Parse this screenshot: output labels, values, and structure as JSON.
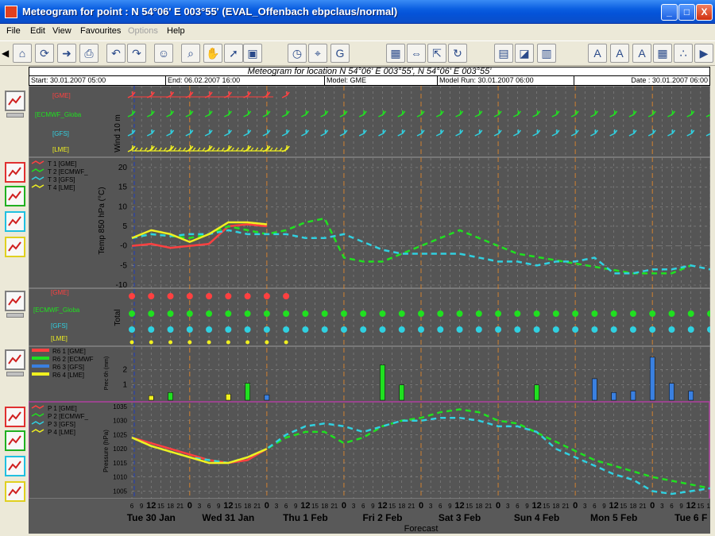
{
  "window": {
    "title": "Meteogram for point : N 54°06' E 003°55' (EVAL_Offenbach ebpclaus/normal)",
    "minimize": "_",
    "maximize": "□",
    "close": "X"
  },
  "menu": [
    "File",
    "Edit",
    "View",
    "Favourites",
    "Options",
    "Help"
  ],
  "menu_disabled": [
    "Options"
  ],
  "toolbar_icons": [
    "back-icon",
    "home-icon",
    "refresh-icon",
    "forward-icon",
    "print-icon",
    "undo-icon",
    "redo-icon",
    "person-icon",
    "zoom-icon",
    "hand-pan-icon",
    "pointer-icon",
    "select-icon",
    "clock-icon",
    "station-icon",
    "gme-icon",
    "grid-icon",
    "arrows-icon",
    "expand-icon",
    "cycle-icon",
    "chart-left-icon",
    "chart-icon",
    "layers-icon",
    "font-plus-icon",
    "font-minus-icon",
    "color-font-icon",
    "table-icon",
    "dots-icon",
    "more-icon"
  ],
  "header": {
    "title": "Meteogram for location N 54°06' E 003°55', N 54°06' E 003°55'",
    "start": "Start: 30.01.2007 05:00",
    "end": "End: 06.02.2007 16:00",
    "model": "Model: GME",
    "run": "Model Run: 30.01.2007 06:00",
    "date": "Date : 30.01.2007 06:00"
  },
  "colors": {
    "gme": "#ff4040",
    "ecmwf": "#20e020",
    "gfs": "#30d0e0",
    "lme": "#f0f020",
    "background": "#555555",
    "pressure_bg": "#5a5a5a"
  },
  "panels": {
    "wind": {
      "ylabel": "Wind 10 m",
      "labels": [
        "[GME]",
        "[ECMWF_Globa",
        "[GFS]",
        "[LME]"
      ]
    },
    "temp": {
      "ylabel": "Temp 850 hPa (°C)",
      "legend": [
        "T 1 [GME]",
        "T 2 [ECMWF_",
        "T 3 [GFS]",
        "T 4 [LME]"
      ],
      "yticks": [
        "20",
        "15",
        "10",
        "5",
        "-0",
        "-5",
        "-10"
      ]
    },
    "cloud": {
      "ylabel": "Total",
      "labels": [
        "[GME]",
        "[ECMWF_Globa",
        "[GFS]",
        "[LME]"
      ]
    },
    "precip": {
      "ylabel": "Prec 6h (mm)",
      "legend": [
        "R6 1 [GME]",
        "R6 2 [ECMWF",
        "R6 3 [GFS]",
        "R6 4 [LME]"
      ],
      "yticks": [
        "2",
        "1"
      ]
    },
    "pressure": {
      "ylabel": "Pressure (hPa)",
      "legend": [
        "P 1 [GME]",
        "P 2 [ECMWF_",
        "P 3 [GFS]",
        "P 4 [LME]"
      ],
      "yticks": [
        "1035",
        "1030",
        "1025",
        "1020",
        "1015",
        "1010",
        "1005"
      ]
    }
  },
  "xaxis": {
    "xlabel": "Forecast",
    "days": [
      "Tue 30 Jan",
      "Wed 31 Jan",
      "Thu 1 Feb",
      "Fri 2 Feb",
      "Sat 3 Feb",
      "Sun 4 Feb",
      "Mon 5 Feb",
      "Tue 6 F"
    ],
    "hour_ticks": [
      "6",
      "9",
      "12",
      "15",
      "18",
      "21",
      "0",
      "3",
      "6",
      "9",
      "12",
      "15",
      "18",
      "21",
      "0",
      "3",
      "6",
      "9",
      "12",
      "15",
      "18",
      "21",
      "0",
      "3",
      "6",
      "9",
      "12",
      "15",
      "18",
      "21",
      "0",
      "3",
      "6",
      "9",
      "12",
      "15",
      "18",
      "21",
      "0",
      "3",
      "6",
      "9",
      "12",
      "15",
      "18",
      "21",
      "0",
      "3",
      "6",
      "9",
      "12",
      "15",
      "18",
      "21",
      "0",
      "3",
      "6",
      "9",
      "12",
      "15",
      "18",
      "21",
      "0",
      "3",
      "6",
      "9",
      "12",
      "15"
    ]
  },
  "chart_data": [
    {
      "type": "line",
      "title": "Temp 850 hPa (°C)",
      "xlabel": "Forecast",
      "ylabel": "Temp 850 hPa (°C)",
      "ylim": [
        -10,
        21
      ],
      "x_hours": [
        0,
        6,
        12,
        18,
        24,
        30,
        36,
        42,
        48,
        54,
        60,
        66,
        72,
        78,
        84,
        90,
        96,
        102,
        108,
        114,
        120,
        126,
        132,
        138,
        144,
        150,
        156,
        162,
        168,
        174,
        180
      ],
      "series": [
        {
          "name": "T 1 [GME]",
          "values": [
            0,
            0.5,
            -0.5,
            0,
            0.5,
            5,
            5.5,
            5,
            null,
            null,
            null,
            null,
            null,
            null,
            null,
            null,
            null,
            null,
            null,
            null,
            null,
            null,
            null,
            null,
            null,
            null,
            null,
            null,
            null,
            null,
            null
          ]
        },
        {
          "name": "T 2 [ECMWF_",
          "values": [
            2,
            3,
            2.5,
            2,
            3,
            5,
            4,
            3,
            4,
            6,
            7,
            -3,
            -4,
            -4,
            -2,
            0,
            2,
            4,
            null,
            null,
            -2,
            null,
            null,
            null,
            null,
            null,
            -7,
            null,
            -7,
            -5,
            null
          ]
        },
        {
          "name": "T 3 [GFS]",
          "values": [
            2,
            3,
            2.5,
            3,
            3,
            4,
            3,
            3,
            3,
            2,
            2,
            3,
            1,
            -1,
            -2,
            -2,
            -2,
            -2,
            -3,
            -4,
            -4,
            -5,
            -4,
            -4,
            -3,
            -7,
            -7,
            -6,
            -6,
            -5,
            -6
          ]
        },
        {
          "name": "T 4 [LME]",
          "values": [
            2,
            4,
            3,
            1,
            3,
            6,
            6,
            5.5,
            null,
            null,
            null,
            null,
            null,
            null,
            null,
            null,
            null,
            null,
            null,
            null,
            null,
            null,
            null,
            null,
            null,
            null,
            null,
            null,
            null,
            null,
            null
          ]
        }
      ]
    },
    {
      "type": "bar",
      "title": "Prec 6h (mm)",
      "ylabel": "Prec 6h (mm)",
      "ylim": [
        0,
        3
      ],
      "bars": [
        {
          "series": "R6 4 [LME]",
          "hour": 6,
          "value": 0.3
        },
        {
          "series": "R6 2 [ECMWF",
          "hour": 12,
          "value": 0.5
        },
        {
          "series": "R6 4 [LME]",
          "hour": 30,
          "value": 0.4
        },
        {
          "series": "R6 2 [ECMWF",
          "hour": 36,
          "value": 1.1
        },
        {
          "series": "R6 3 [GFS]",
          "hour": 42,
          "value": 0.35
        },
        {
          "series": "R6 2 [ECMWF",
          "hour": 78,
          "value": 2.3
        },
        {
          "series": "R6 2 [ECMWF",
          "hour": 84,
          "value": 1.0
        },
        {
          "series": "R6 2 [ECMWF",
          "hour": 126,
          "value": 1.0
        },
        {
          "series": "R6 3 [GFS]",
          "hour": 144,
          "value": 1.4
        },
        {
          "series": "R6 3 [GFS]",
          "hour": 150,
          "value": 0.5
        },
        {
          "series": "R6 3 [GFS]",
          "hour": 156,
          "value": 0.6
        },
        {
          "series": "R6 3 [GFS]",
          "hour": 162,
          "value": 2.8
        },
        {
          "series": "R6 3 [GFS]",
          "hour": 168,
          "value": 1.1
        },
        {
          "series": "R6 3 [GFS]",
          "hour": 174,
          "value": 0.6
        }
      ]
    },
    {
      "type": "line",
      "title": "Pressure (hPa)",
      "ylabel": "Pressure (hPa)",
      "ylim": [
        1004,
        1035
      ],
      "x_hours": [
        0,
        6,
        12,
        18,
        24,
        30,
        36,
        42,
        48,
        54,
        60,
        66,
        72,
        78,
        84,
        90,
        96,
        102,
        108,
        114,
        120,
        126,
        132,
        138,
        144,
        150,
        156,
        162,
        168,
        174,
        180
      ],
      "series": [
        {
          "name": "P 1 [GME]",
          "values": [
            1024,
            1022,
            1020,
            1018,
            1016,
            1015,
            1016,
            1020,
            null,
            null,
            null,
            null,
            null,
            null,
            null,
            null,
            null,
            null,
            null,
            null,
            null,
            null,
            null,
            null,
            null,
            null,
            null,
            null,
            null,
            null,
            null
          ]
        },
        {
          "name": "P 2 [ECMWF_",
          "values": [
            1024,
            1021,
            1019,
            1017,
            1016,
            1015,
            1017,
            1020,
            1024,
            1026,
            1026,
            1022,
            1024,
            1028,
            1030,
            1031,
            1033,
            1034,
            1033,
            1030,
            1029,
            null,
            null,
            null,
            1016,
            null,
            null,
            1010,
            null,
            null,
            1006
          ]
        },
        {
          "name": "P 3 [GFS]",
          "values": [
            1024,
            1021,
            1019,
            1017,
            1016,
            1015,
            1017,
            1020,
            1025,
            1028,
            1029,
            1028,
            1026,
            1028,
            1030,
            1030,
            1031,
            1031,
            1030,
            1028,
            1028,
            1026,
            1020,
            1017,
            1014,
            1011,
            1009,
            1005,
            1004,
            1005,
            1006
          ]
        },
        {
          "name": "P 4 [LME]",
          "values": [
            1024,
            1021,
            1019,
            1017,
            1015,
            1015,
            1017,
            1020,
            null,
            null,
            null,
            null,
            null,
            null,
            null,
            null,
            null,
            null,
            null,
            null,
            null,
            null,
            null,
            null,
            null,
            null,
            null,
            null,
            null,
            null,
            null
          ]
        }
      ]
    }
  ]
}
